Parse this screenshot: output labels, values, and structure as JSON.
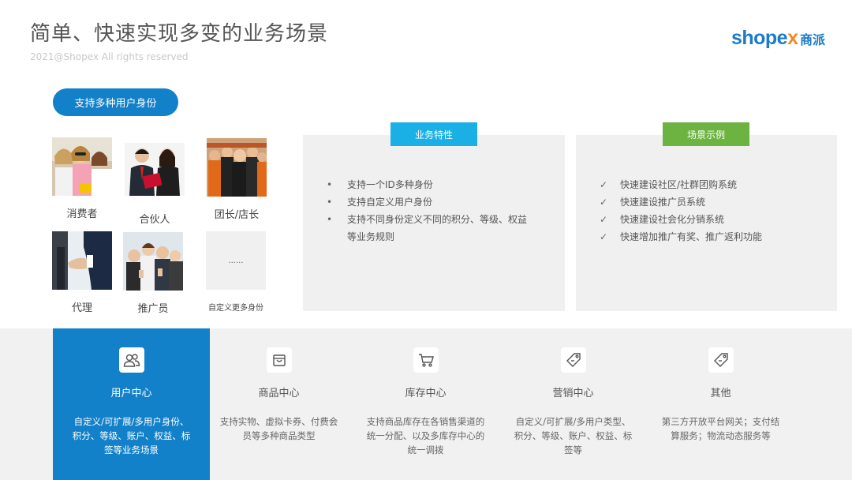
{
  "header": {
    "title": "简单、快速实现多变的业务场景",
    "copyright": "2021@Shopex All rights reserved"
  },
  "logo": {
    "shop": "shope",
    "x": "x",
    "cn": "商派"
  },
  "identity_button": "支持多种用户身份",
  "personas": [
    {
      "label": "消费者"
    },
    {
      "label": "合伙人"
    },
    {
      "label": "团长/店长"
    },
    {
      "label": "代理"
    },
    {
      "label": "推广员"
    },
    {
      "label": "自定义更多身份",
      "placeholder": "......"
    }
  ],
  "features_panel": {
    "tag": "业务特性",
    "items": [
      "支持一个ID多种身份",
      "支持自定义用户身份",
      "支持不同身份定义不同的积分、等级、权益",
      "等业务规则"
    ]
  },
  "scenarios_panel": {
    "tag": "场景示例",
    "items": [
      "快速建设社区/社群团购系统",
      "快速建设推广员系统",
      "快速建设社会化分销系统",
      "快速增加推广有奖、推广返利功能"
    ]
  },
  "modules": [
    {
      "name": "用户中心",
      "icon": "users-icon",
      "desc_lines": [
        "自定义/可扩展/多用户身份、",
        "积分、等级、账户、权益、标",
        "签等业务场景"
      ]
    },
    {
      "name": "商品中心",
      "icon": "bag-icon",
      "desc_lines": [
        "支持实物、虚拟卡券、付费会",
        "员等多种商品类型"
      ]
    },
    {
      "name": "库存中心",
      "icon": "cart-icon",
      "desc_lines": [
        "支持商品库存在各销售渠道的",
        "统一分配、以及多库存中心的",
        "统一调拨"
      ]
    },
    {
      "name": "营销中心",
      "icon": "tag-icon",
      "desc_lines": [
        "自定义/可扩展/多用户类型、",
        "积分、等级、账户、权益、标",
        "签等"
      ]
    },
    {
      "name": "其他",
      "icon": "tag-icon",
      "desc_lines": [
        "第三方开放平台网关；支付结",
        "算服务；物流动态服务等"
      ]
    }
  ],
  "colors": {
    "brand_blue": "#1281c9",
    "feature_tag": "#1ab0e6",
    "scenario_tag": "#6cb341",
    "logo_orange": "#f08a24"
  }
}
